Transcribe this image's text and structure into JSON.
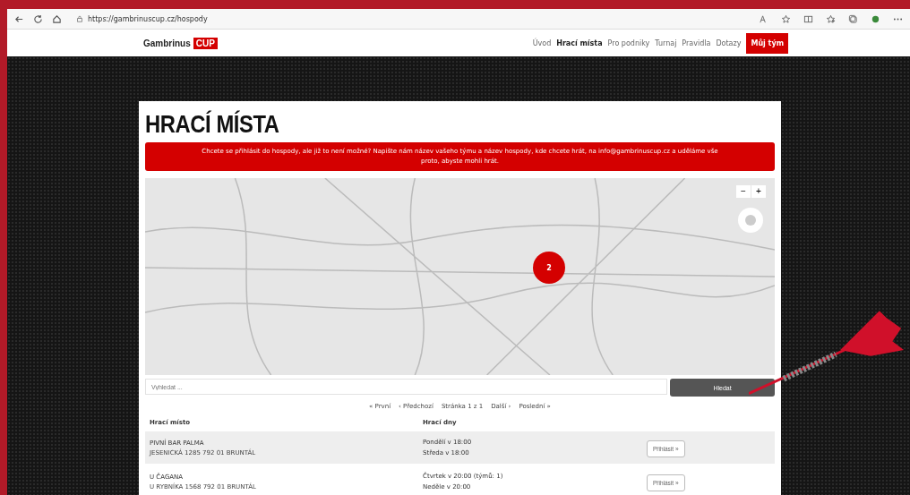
{
  "browser": {
    "url": "https://gambrinuscup.cz/hospody"
  },
  "site": {
    "logo_word": "Gambrinus",
    "logo_badge": "CUP",
    "nav": [
      {
        "label": "Úvod",
        "selected": false
      },
      {
        "label": "Hrací místa",
        "selected": true
      },
      {
        "label": "Pro podniky",
        "selected": false
      },
      {
        "label": "Turnaj",
        "selected": false
      },
      {
        "label": "Pravidla",
        "selected": false
      },
      {
        "label": "Dotazy",
        "selected": false
      }
    ],
    "team_button": "Můj tým"
  },
  "page": {
    "title": "HRACÍ MÍSTA",
    "alert": "Chcete se přihlásit do hospody, ale již to není možné? Napište nám název vašeho týmu a název hospody, kde chcete hrát, na info@gambrinuscup.cz a uděláme vše proto, abyste mohli hrát.",
    "map": {
      "cluster_count": "2",
      "zoom_out": "−",
      "zoom_in": "+"
    },
    "search": {
      "placeholder": "Vyhledat ...",
      "button": "Hledat"
    },
    "pagination": [
      "« První",
      "‹ Předchozí",
      "Stránka 1 z 1",
      "Další ›",
      "Poslední »"
    ],
    "table": {
      "columns": [
        "Hrací místo",
        "Hrací dny"
      ],
      "rows": [
        {
          "name": "PIVNÍ BAR PALMA",
          "address": "JESENICKÁ 1285 792 01 BRUNTÁL",
          "days": [
            "Pondělí v 18:00",
            "Středa v 18:00"
          ],
          "action": "Přihlásit »"
        },
        {
          "name": "U ČAGANA",
          "address": "U RYBNÍKA 1568 792 01 BRUNTÁL",
          "days": [
            "Čtvrtek v 20:00 (týmů: 1)",
            "Neděle v 20:00"
          ],
          "action": "Přihlásit »"
        }
      ]
    }
  }
}
